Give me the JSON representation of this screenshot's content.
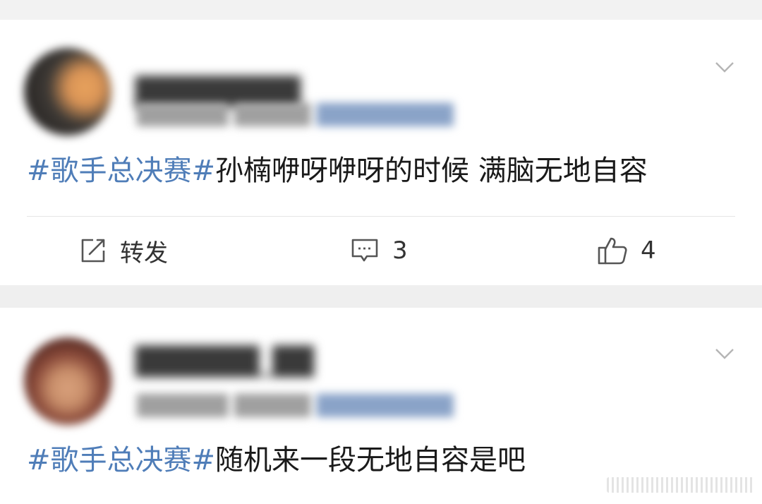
{
  "posts": [
    {
      "hashtag": "#歌手总决赛#",
      "body": "孙楠咿呀咿呀的时候 满脑无地自容",
      "actions": {
        "repost_label": "转发",
        "comment_count": "3",
        "like_count": "4"
      }
    },
    {
      "hashtag": "#歌手总决赛#",
      "body": "随机来一段无地自容是吧"
    }
  ],
  "colors": {
    "hashtag": "#4f7db8",
    "text": "#1a1a1a",
    "icon": "#555555",
    "background": "#efefef",
    "card": "#ffffff"
  },
  "icons": {
    "more": "chevron-down-icon",
    "repost": "repost-icon",
    "comment": "comment-icon",
    "like": "thumbs-up-icon"
  }
}
